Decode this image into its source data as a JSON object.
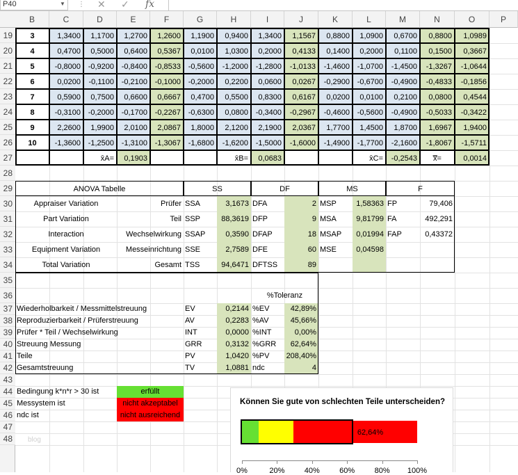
{
  "name_box": "P40",
  "formula": {
    "cancel_glyph": "✕",
    "enter_glyph": "✓",
    "fx_label": "fx",
    "value": ""
  },
  "columns": [
    "B",
    "C",
    "D",
    "E",
    "F",
    "G",
    "H",
    "I",
    "J",
    "K",
    "L",
    "M",
    "N",
    "O",
    "P"
  ],
  "rows": [
    "19",
    "20",
    "21",
    "22",
    "23",
    "24",
    "25",
    "26",
    "27",
    "28",
    "29",
    "30",
    "31",
    "32",
    "33",
    "34",
    "35",
    "36",
    "37",
    "38",
    "39",
    "40",
    "41",
    "42",
    "43",
    "44",
    "45",
    "46",
    "47",
    "48"
  ],
  "measurements": [
    {
      "part": "3",
      "values": [
        "1,3400",
        "1,1700",
        "1,2700",
        "1,2600",
        "1,1900",
        "0,9400",
        "1,3400",
        "1,1567",
        "0,8800",
        "1,0900",
        "0,6700",
        "0,8800",
        "1,0989"
      ]
    },
    {
      "part": "4",
      "values": [
        "0,4700",
        "0,5000",
        "0,6400",
        "0,5367",
        "0,0100",
        "1,0300",
        "0,2000",
        "0,4133",
        "0,1400",
        "0,2000",
        "0,1100",
        "0,1500",
        "0,3667"
      ]
    },
    {
      "part": "5",
      "values": [
        "-0,8000",
        "-0,9200",
        "-0,8400",
        "-0,8533",
        "-0,5600",
        "-1,2000",
        "-1,2800",
        "-1,0133",
        "-1,4600",
        "-1,0700",
        "-1,4500",
        "-1,3267",
        "-1,0644"
      ]
    },
    {
      "part": "6",
      "values": [
        "0,0200",
        "-0,1100",
        "-0,2100",
        "-0,1000",
        "-0,2000",
        "0,2200",
        "0,0600",
        "0,0267",
        "-0,2900",
        "-0,6700",
        "-0,4900",
        "-0,4833",
        "-0,1856"
      ]
    },
    {
      "part": "7",
      "values": [
        "0,5900",
        "0,7500",
        "0,6600",
        "0,6667",
        "0,4700",
        "0,5500",
        "0,8300",
        "0,6167",
        "0,0200",
        "0,0100",
        "0,2100",
        "0,0800",
        "0,4544"
      ]
    },
    {
      "part": "8",
      "values": [
        "-0,3100",
        "-0,2000",
        "-0,1700",
        "-0,2267",
        "-0,6300",
        "0,0800",
        "-0,3400",
        "-0,2967",
        "-0,4600",
        "-0,5600",
        "-0,4900",
        "-0,5033",
        "-0,3422"
      ]
    },
    {
      "part": "9",
      "values": [
        "2,2600",
        "1,9900",
        "2,0100",
        "2,0867",
        "1,8000",
        "2,1200",
        "2,1900",
        "2,0367",
        "1,7700",
        "1,4500",
        "1,8700",
        "1,6967",
        "1,9400"
      ]
    },
    {
      "part": "10",
      "values": [
        "-1,3600",
        "-1,2500",
        "-1,3100",
        "-1,3067",
        "-1,6800",
        "-1,6200",
        "-1,5000",
        "-1,6000",
        "-1,4900",
        "-1,7700",
        "-2,1600",
        "-1,8067",
        "-1,5711"
      ]
    }
  ],
  "means": {
    "a_label": "x̄A=",
    "a_value": "0,1903",
    "b_label": "x̄B=",
    "b_value": "0,0683",
    "c_label": "x̄C=",
    "c_value": "-0,2543",
    "all_label": "x̿=",
    "all_value": "0,0014"
  },
  "anova": {
    "title": "ANOVA Tabelle",
    "headers": {
      "ss": "SS",
      "df": "DF",
      "ms": "MS",
      "f": "F"
    },
    "rows": [
      {
        "source": "Appraiser Variation",
        "de": "Prüfer",
        "ss_sym": "SSA",
        "ss": "3,1673",
        "df_sym": "DFA",
        "df": "2",
        "ms_sym": "MSP",
        "ms": "1,58363",
        "f_sym": "FP",
        "f": "79,406"
      },
      {
        "source": "Part Variation",
        "de": "Teil",
        "ss_sym": "SSP",
        "ss": "88,3619",
        "df_sym": "DFP",
        "df": "9",
        "ms_sym": "MSA",
        "ms": "9,81799",
        "f_sym": "FA",
        "f": "492,291"
      },
      {
        "source": "Interaction",
        "de": "Wechselwirkung",
        "ss_sym": "SSAP",
        "ss": "0,3590",
        "df_sym": "DFAP",
        "df": "18",
        "ms_sym": "MSAP",
        "ms": "0,01994",
        "f_sym": "FAP",
        "f": "0,43372"
      },
      {
        "source": "Equipment Variation",
        "de": "Messeinrichtung",
        "ss_sym": "SSE",
        "ss": "2,7589",
        "df_sym": "DFE",
        "df": "60",
        "ms_sym": "MSE",
        "ms": "0,04598",
        "f_sym": "",
        "f": ""
      },
      {
        "source": "Total Variation",
        "de": "Gesamt",
        "ss_sym": "TSS",
        "ss": "94,6471",
        "df_sym": "DFTSS",
        "df": "89",
        "ms_sym": "",
        "ms": "",
        "f_sym": "",
        "f": ""
      }
    ]
  },
  "grr": {
    "header": "%Toleranz",
    "rows": [
      {
        "label": "Wiederholbarkeit / Messmittelstreuung",
        "sym": "EV",
        "val": "0,2144",
        "pct_sym": "%EV",
        "pct": "42,89%"
      },
      {
        "label": "Reproduzierbarkeit / Prüferstreuung",
        "sym": "AV",
        "val": "0,2283",
        "pct_sym": "%AV",
        "pct": "45,66%"
      },
      {
        "label": "Prüfer * Teil / Wechselwirkung",
        "sym": "INT",
        "val": "0,0000",
        "pct_sym": "%INT",
        "pct": "0,00%"
      },
      {
        "label": "Streuung Messung",
        "sym": "GRR",
        "val": "0,3132",
        "pct_sym": "%GRR",
        "pct": "62,64%"
      },
      {
        "label": "Teile",
        "sym": "PV",
        "val": "1,0420",
        "pct_sym": "%PV",
        "pct": "208,40%"
      },
      {
        "label": "Gesamtstreuung",
        "sym": "TV",
        "val": "1,0881",
        "pct_sym": "ndc",
        "pct": "4"
      }
    ]
  },
  "conditions": [
    {
      "label": "Bedingung k*n*r > 30 ist",
      "status": "erfüllt",
      "color": "#66e033"
    },
    {
      "label": "Messystem ist",
      "status": "nicht akzeptabel",
      "color": "#ff0000"
    },
    {
      "label": "ndc ist",
      "status": "nicht ausreichend",
      "color": "#ff0000"
    }
  ],
  "watermark": "blog",
  "chart_data": {
    "type": "bar",
    "title": "Können Sie gute von schlechten Teile unterscheiden?",
    "value": 62.64,
    "value_label": "62,64%",
    "bands": [
      {
        "from": 0,
        "to": 10,
        "color": "#66e033"
      },
      {
        "from": 10,
        "to": 30,
        "color": "#ffff00"
      },
      {
        "from": 30,
        "to": 100,
        "color": "#ff0000"
      }
    ],
    "xlim": [
      0,
      100
    ],
    "tick_labels": [
      "0%",
      "20%",
      "40%",
      "60%",
      "80%",
      "100%"
    ]
  }
}
